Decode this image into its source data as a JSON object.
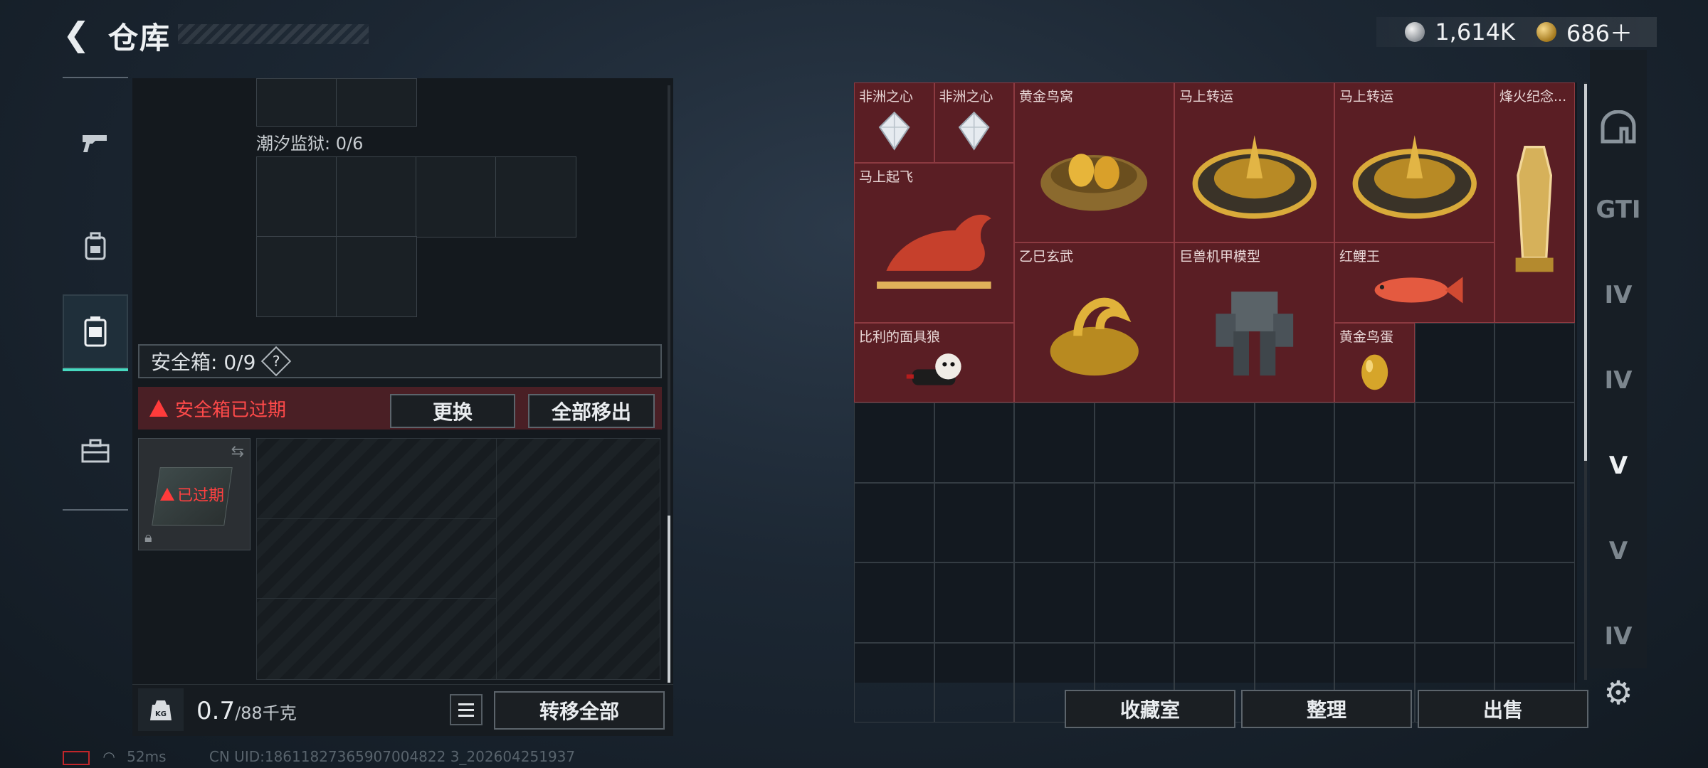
{
  "header": {
    "title": "仓库",
    "currencies": [
      {
        "icon": "silver-coin-icon",
        "value": "1,614K"
      },
      {
        "icon": "gold-coin-icon",
        "value": "686＋"
      }
    ]
  },
  "left_nav": {
    "items": [
      {
        "icon": "gun-icon",
        "active": false
      },
      {
        "icon": "backpack-icon",
        "active": false
      },
      {
        "icon": "container-icon",
        "active": true
      },
      {
        "icon": "toolbox-icon",
        "active": false
      }
    ]
  },
  "left_panel": {
    "tidal_prison_label": "潮汐监狱: 0/6",
    "safebox_label": "安全箱: 0/9",
    "help_glyph": "?",
    "expired_warning": "安全箱已过期",
    "replace_button": "更换",
    "remove_all_button": "全部移出",
    "slot_expired_label": "已过期",
    "weight_value": "0.7",
    "weight_max": "/88千克",
    "transfer_all_button": "转移全部",
    "kg_label": "KG"
  },
  "items": [
    {
      "name": "非洲之心",
      "art": "diamond"
    },
    {
      "name": "非洲之心",
      "art": "diamond"
    },
    {
      "name": "黄金鸟窝",
      "art": "nest"
    },
    {
      "name": "马上转运",
      "art": "wheel"
    },
    {
      "name": "马上转运",
      "art": "wheel"
    },
    {
      "name": "烽火纪念...",
      "art": "trophy"
    },
    {
      "name": "马上起飞",
      "art": "horse"
    },
    {
      "name": "乙巳玄武",
      "art": "gold-dragon"
    },
    {
      "name": "巨兽机甲模型",
      "art": "mech"
    },
    {
      "name": "红鲤王",
      "art": "carp"
    },
    {
      "name": "比利的面具狼",
      "art": "puppet"
    },
    {
      "name": "黄金鸟蛋",
      "art": "egg"
    }
  ],
  "right_nav": {
    "items": [
      {
        "icon": "bunker-icon",
        "label": "",
        "active": false
      },
      {
        "icon": "gti-card-icon",
        "label": "GTI",
        "active": false
      },
      {
        "icon": "folder-iv-icon",
        "label": "IV",
        "active": false
      },
      {
        "icon": "folder-iv-icon",
        "label": "IV",
        "active": false
      },
      {
        "icon": "card-v-icon",
        "label": "V",
        "active": true
      },
      {
        "icon": "card-v-icon",
        "label": "V",
        "active": false
      },
      {
        "icon": "card-iv-icon",
        "label": "IV",
        "active": false
      }
    ]
  },
  "bottom_buttons": {
    "collection": "收藏室",
    "organize": "整理",
    "sell": "出售"
  },
  "status": {
    "ping": "52ms",
    "uid": "CN UID:18611827365907004822 3_202604251937"
  }
}
